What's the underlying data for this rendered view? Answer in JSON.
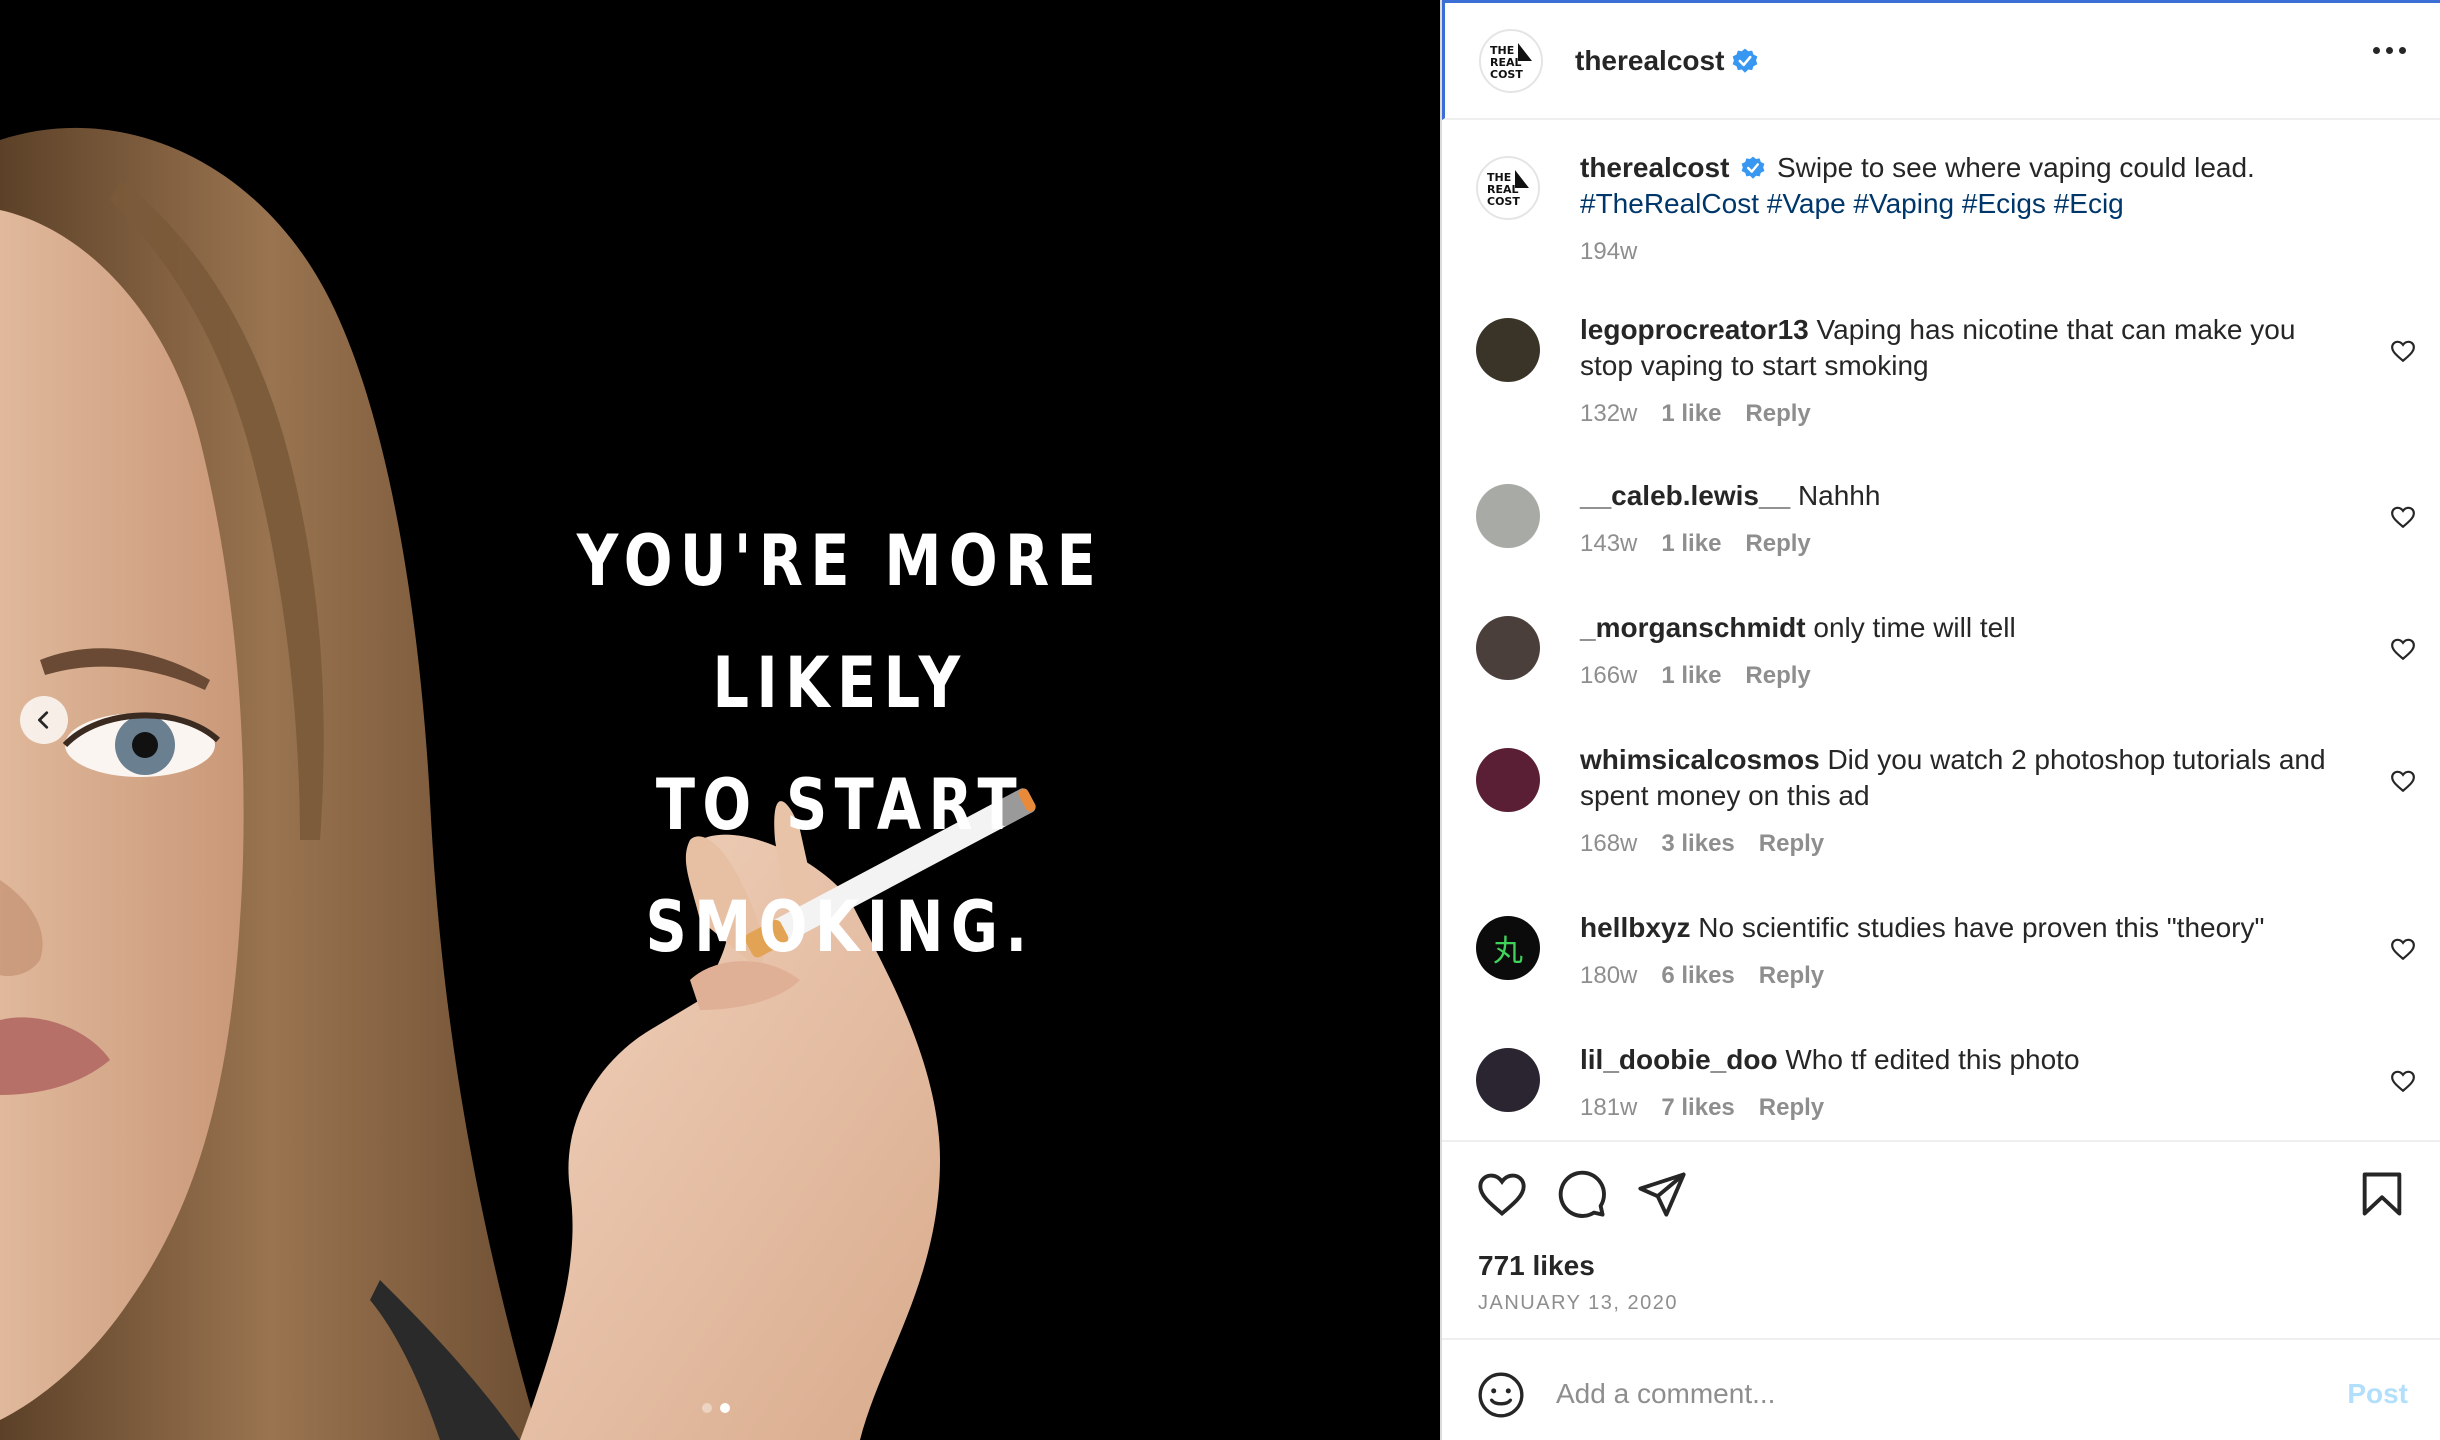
{
  "post": {
    "headline_line1": "YOU'RE MORE LIKELY",
    "headline_line2": "TO START SMOKING.",
    "carousel": {
      "total": 2,
      "current": 2
    }
  },
  "header": {
    "username": "therealcost",
    "logo_text": "THE REAL COST"
  },
  "caption": {
    "username": "therealcost",
    "text": "Swipe to see where vaping could lead.",
    "hashtags": "#TheRealCost #Vape #Vaping #Ecigs #Ecig",
    "time": "194w"
  },
  "comments": [
    {
      "username": "legoprocreator13",
      "text": "Vaping has nicotine that can make you stop vaping to start smoking",
      "time": "132w",
      "likes": "1 like",
      "reply": "Reply",
      "avatar_color": "#3a3428"
    },
    {
      "username": "__caleb.lewis__",
      "text": "Nahhh",
      "time": "143w",
      "likes": "1 like",
      "reply": "Reply",
      "avatar_color": "#a8aaa6"
    },
    {
      "username": "_morganschmidt",
      "text": "only time will tell",
      "time": "166w",
      "likes": "1 like",
      "reply": "Reply",
      "avatar_color": "#4b3f3c"
    },
    {
      "username": "whimsicalcosmos",
      "text": "Did you watch 2 photoshop tutorials and spent money on this ad",
      "time": "168w",
      "likes": "3 likes",
      "reply": "Reply",
      "avatar_color": "#5a1f35"
    },
    {
      "username": "hellbxyz",
      "text": "No scientific studies have proven this \"theory\"",
      "time": "180w",
      "likes": "6 likes",
      "reply": "Reply",
      "avatar_color": "#0b0b0b",
      "avatar_glyph": "丸"
    },
    {
      "username": "lil_doobie_doo",
      "text": "Who tf edited this photo",
      "time": "181w",
      "likes": "7 likes",
      "reply": "Reply",
      "avatar_color": "#2a2530"
    }
  ],
  "footer": {
    "likes": "771 likes",
    "date": "JANUARY 13, 2020",
    "comment_placeholder": "Add a comment...",
    "post_label": "Post"
  },
  "colors": {
    "verified": "#3897f0",
    "hashtag": "#00376b",
    "muted": "#8e8e8e",
    "post_disabled": "#b2dffc"
  },
  "icons": [
    "chevron-left-icon",
    "more-icon",
    "verified-icon",
    "heart-icon",
    "comment-icon",
    "share-icon",
    "bookmark-icon",
    "emoji-icon"
  ]
}
